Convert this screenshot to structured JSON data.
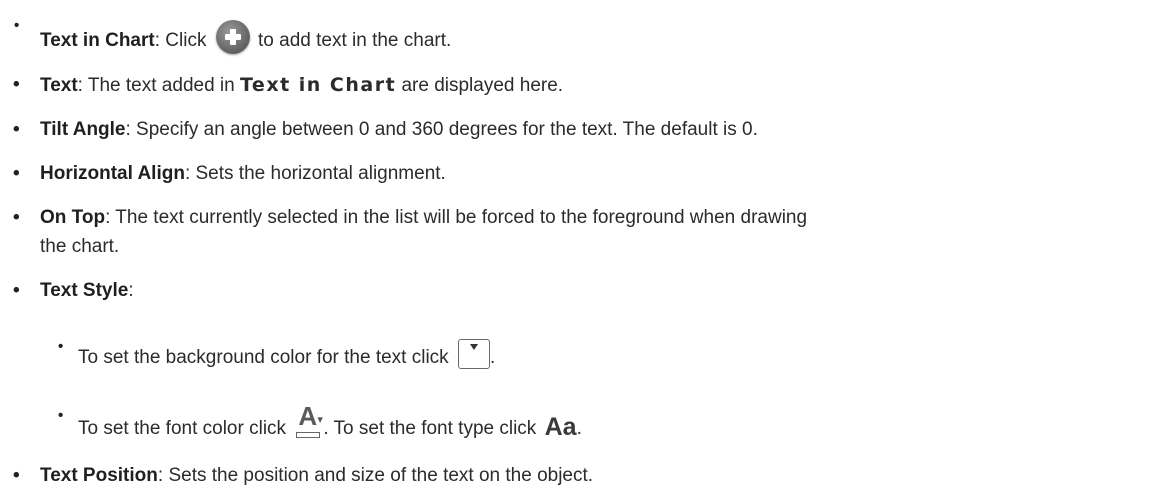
{
  "items": [
    {
      "label": "Text in Chart",
      "text_before_icon": ": Click ",
      "icon": "plus-circle-icon",
      "text_after_icon": " to add text in the chart."
    },
    {
      "label": "Text",
      "text_a": ": The text added in ",
      "code": "Text in Chart",
      "text_b": " are displayed here."
    },
    {
      "label": "Tilt Angle",
      "text": ": Specify an angle between 0 and 360 degrees for the text. The default is 0."
    },
    {
      "label": "Horizontal Align",
      "text": ": Sets the horizontal alignment."
    },
    {
      "label": "On Top",
      "text": ": The text currently selected in the list will be forced to the foreground when drawing",
      "text_cont": "the chart."
    },
    {
      "label": "Text Style",
      "text": ":"
    },
    {
      "label": "Text Position",
      "text": ": Sets the position and size of the text on the object."
    }
  ],
  "sub_items": [
    {
      "text": "To set the background color for the text click ",
      "icon": "dropdown-box-icon",
      "suffix": "."
    },
    {
      "text_a": "To set the font color click ",
      "icon_a": "font-color-icon",
      "text_b": ". To set the font type click ",
      "icon_b": "font-type-icon",
      "icon_b_text": "Aa",
      "suffix": "."
    }
  ],
  "bullet_char": "•"
}
